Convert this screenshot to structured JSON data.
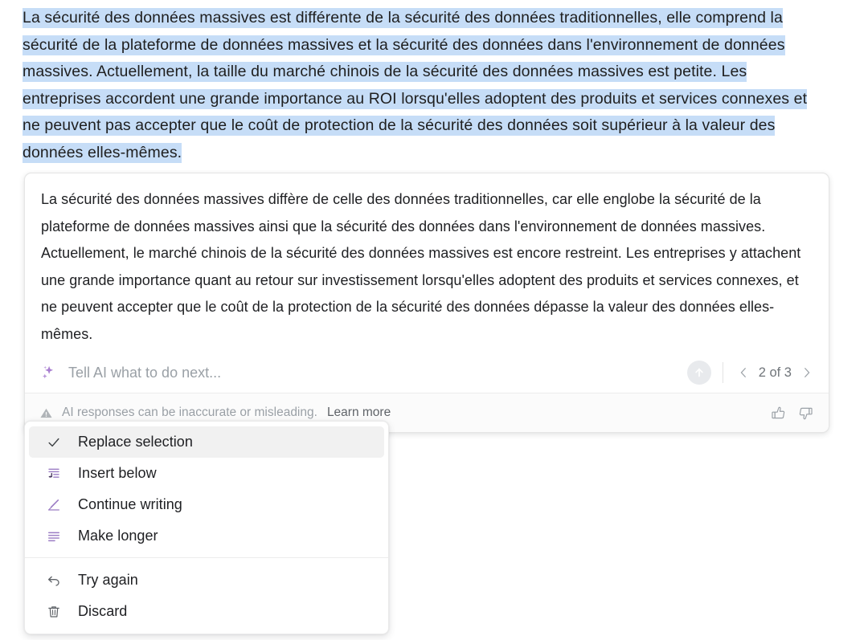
{
  "document": {
    "selected_paragraph": "La sécurité des données massives est différente de la sécurité des données traditionnelles, elle comprend la sécurité de la plateforme de données massives et la sécurité des données dans l'environnement de données massives. Actuellement, la taille du marché chinois de la sécurité des données massives est petite. Les entreprises accordent une grande importance au ROI lorsqu'elles adoptent des produits et services connexes et ne peuvent pas accepter que le coût de protection de la sécurité des données soit supérieur à la valeur des données elles-mêmes.",
    "selection_highlight_color": "#c6ddf7"
  },
  "ai_card": {
    "response_text": "La sécurité des données massives diffère de celle des données traditionnelles, car elle englobe la sécurité de la plateforme de données massives ainsi que la sécurité des données dans l'environnement de données massives. Actuellement, le marché chinois de la sécurité des données massives est encore restreint. Les entreprises y attachent une grande importance quant au retour sur investissement lorsqu'elles adoptent des produits et services connexes, et ne peuvent accepter que le coût de la protection de la sécurité des données dépasse la valeur des données elles-mêmes.",
    "prompt": {
      "icon": "sparkle-icon",
      "placeholder": "Tell AI what to do next...",
      "value": "",
      "accent_color": "#a97fd0"
    },
    "submit": {
      "icon": "arrow-up-icon",
      "label": "Submit",
      "background_color": "#e8eaed"
    },
    "pager": {
      "prev_icon": "chevron-left-icon",
      "next_icon": "chevron-right-icon",
      "label": "2 of 3",
      "current": 2,
      "total": 3
    },
    "footer": {
      "warning_icon": "warning-triangle-icon",
      "disclaimer": "AI responses can be inaccurate or misleading.",
      "learn_more": "Learn more",
      "thumbs_up_icon": "thumbs-up-icon",
      "thumbs_down_icon": "thumbs-down-icon"
    }
  },
  "menu": {
    "accent_color": "#9b7cc4",
    "items": [
      {
        "id": "replace-selection",
        "label": "Replace selection",
        "icon": "check-icon",
        "selected": true,
        "icon_color": "#3c4043"
      },
      {
        "id": "insert-below",
        "label": "Insert below",
        "icon": "insert-below-icon",
        "selected": false,
        "icon_color": "#9b7cc4"
      },
      {
        "id": "continue-writing",
        "label": "Continue writing",
        "icon": "pencil-icon",
        "selected": false,
        "icon_color": "#9b7cc4"
      },
      {
        "id": "make-longer",
        "label": "Make longer",
        "icon": "lines-icon",
        "selected": false,
        "icon_color": "#9b7cc4"
      }
    ],
    "items_secondary": [
      {
        "id": "try-again",
        "label": "Try again",
        "icon": "undo-arrow-icon",
        "icon_color": "#5f6368"
      },
      {
        "id": "discard",
        "label": "Discard",
        "icon": "trash-icon",
        "icon_color": "#5f6368"
      }
    ]
  }
}
